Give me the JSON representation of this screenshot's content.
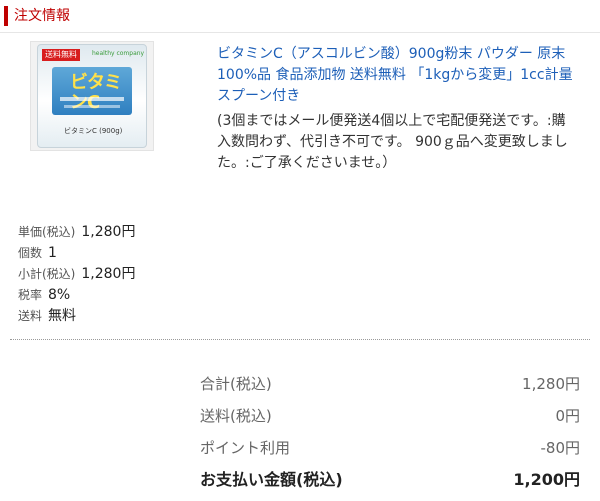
{
  "section": {
    "title": "注文情報"
  },
  "product": {
    "image": {
      "badge": "送料無料",
      "brand": "healthy company",
      "logo": "ビタミンC",
      "name": "ビタミンC (900g)"
    },
    "title": "ビタミンC（アスコルビン酸）900g粉末 パウダー 原末 100%品 食品添加物 送料無料 「1kgから変更」1cc計量スプーン付き",
    "note": "(3個まではメール便発送4個以上で宅配便発送です。:購入数問わず、代引き不可です。 900ｇ品へ変更致しました。:ご了承くださいませ。）"
  },
  "details": [
    {
      "label": "単価(税込)",
      "value": "1,280円"
    },
    {
      "label": "個数",
      "value": "1"
    },
    {
      "label": "小計(税込)",
      "value": "1,280円"
    },
    {
      "label": "税率",
      "value": "8%"
    },
    {
      "label": "送料",
      "value": "無料"
    }
  ],
  "summary": {
    "subtotal": {
      "label": "合計(税込)",
      "value": "1,280円"
    },
    "shipping": {
      "label": "送料(税込)",
      "value": "0円"
    },
    "points": {
      "label": "ポイント利用",
      "value": "-80円"
    },
    "total": {
      "label": "お支払い金額(税込)",
      "value": "1,200円"
    }
  },
  "colors": {
    "accent": "#bf0000",
    "link": "#1d5fb8"
  }
}
